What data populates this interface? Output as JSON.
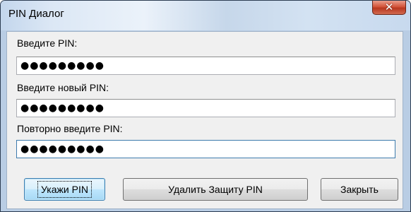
{
  "window": {
    "title": "PIN Диалог"
  },
  "fields": {
    "pin": {
      "label": "Введите PIN:",
      "value": "●●●●●●●●●"
    },
    "new_pin": {
      "label": "Введите новый PIN:",
      "value": "●●●●●●●●●"
    },
    "repeat_pin": {
      "label": "Повторно введите PIN:",
      "value": "●●●●●●●●●"
    }
  },
  "buttons": {
    "set_pin": "Укажи PIN",
    "remove_protection": "Удалить Защиту  PIN",
    "close": "Закрыть"
  },
  "icons": {
    "close": "close-icon"
  },
  "colors": {
    "close_button": "#c8462c",
    "title_bar": "#d4e3f3"
  }
}
